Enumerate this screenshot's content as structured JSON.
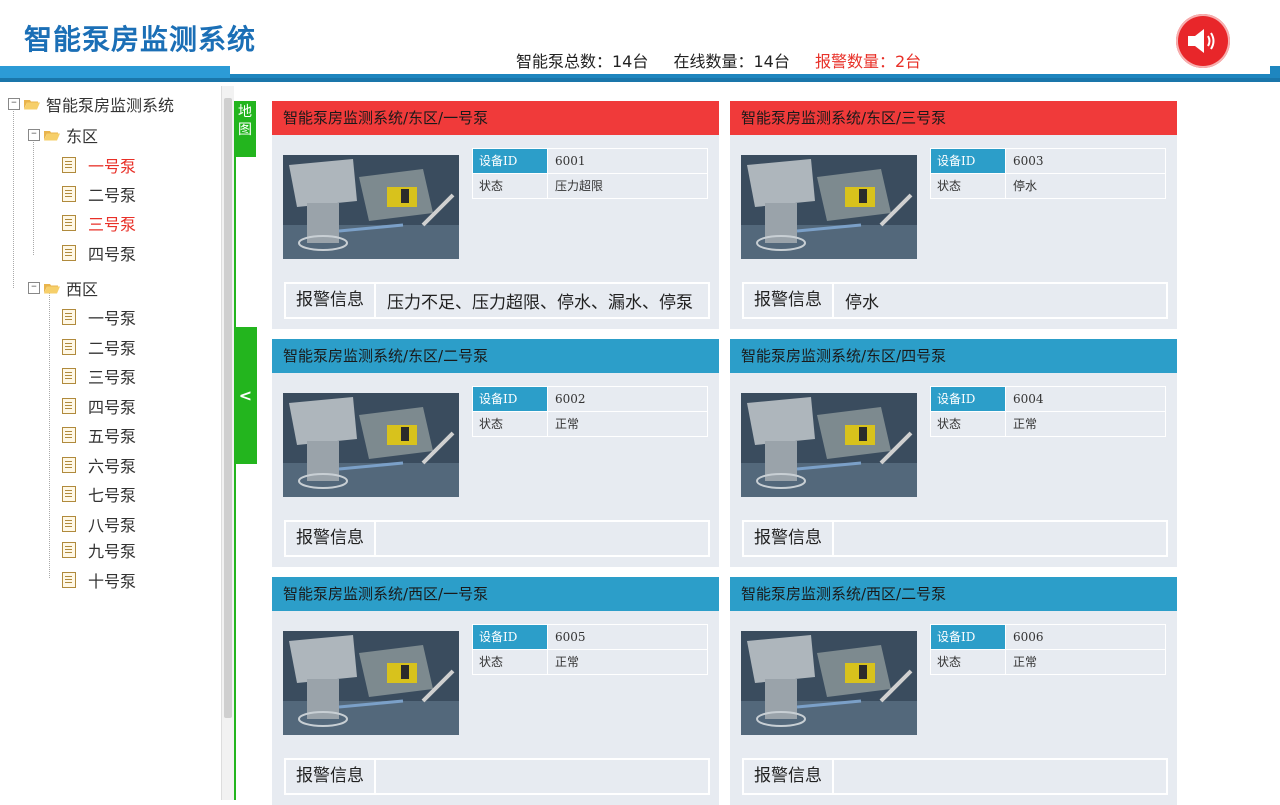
{
  "header": {
    "title": "智能泵房监测系统",
    "stats": {
      "total": "智能泵总数：14台",
      "online": "在线数量：14台",
      "alarm": "报警数量：2台"
    }
  },
  "tree": {
    "root": "智能泵房监测系统",
    "east": {
      "label": "东区",
      "items": [
        {
          "label": "一号泵",
          "alarm": true
        },
        {
          "label": "二号泵",
          "alarm": false
        },
        {
          "label": "三号泵",
          "alarm": true
        },
        {
          "label": "四号泵",
          "alarm": false
        }
      ]
    },
    "west": {
      "label": "西区",
      "items": [
        {
          "label": "一号泵"
        },
        {
          "label": "二号泵"
        },
        {
          "label": "三号泵"
        },
        {
          "label": "四号泵"
        },
        {
          "label": "五号泵"
        },
        {
          "label": "六号泵"
        },
        {
          "label": "七号泵"
        },
        {
          "label": "八号泵"
        },
        {
          "label": "九号泵"
        },
        {
          "label": "十号泵"
        }
      ]
    }
  },
  "side_tabs": {
    "map": "地图",
    "collapse": "<"
  },
  "labels": {
    "device_id": "设备ID",
    "status": "状态",
    "alarm_info": "报警信息"
  },
  "cards": [
    {
      "title": "智能泵房监测系统/东区/一号泵",
      "device_id": "6001",
      "status": "压力超限",
      "alarm_info": "压力不足、压力超限、停水、漏水、停泵",
      "alarm": true
    },
    {
      "title": "智能泵房监测系统/东区/三号泵",
      "device_id": "6003",
      "status": "停水",
      "alarm_info": "停水",
      "alarm": true
    },
    {
      "title": "智能泵房监测系统/东区/二号泵",
      "device_id": "6002",
      "status": "正常",
      "alarm_info": "",
      "alarm": false
    },
    {
      "title": "智能泵房监测系统/东区/四号泵",
      "device_id": "6004",
      "status": "正常",
      "alarm_info": "",
      "alarm": false
    },
    {
      "title": "智能泵房监测系统/西区/一号泵",
      "device_id": "6005",
      "status": "正常",
      "alarm_info": "",
      "alarm": false
    },
    {
      "title": "智能泵房监测系统/西区/二号泵",
      "device_id": "6006",
      "status": "正常",
      "alarm_info": "",
      "alarm": false
    }
  ],
  "colors": {
    "brand": "#1b6fb6",
    "alarm": "#e83028",
    "normal_head": "#2c9ec9",
    "alarm_head": "#f03a3a",
    "tab_green": "#23b51e"
  }
}
